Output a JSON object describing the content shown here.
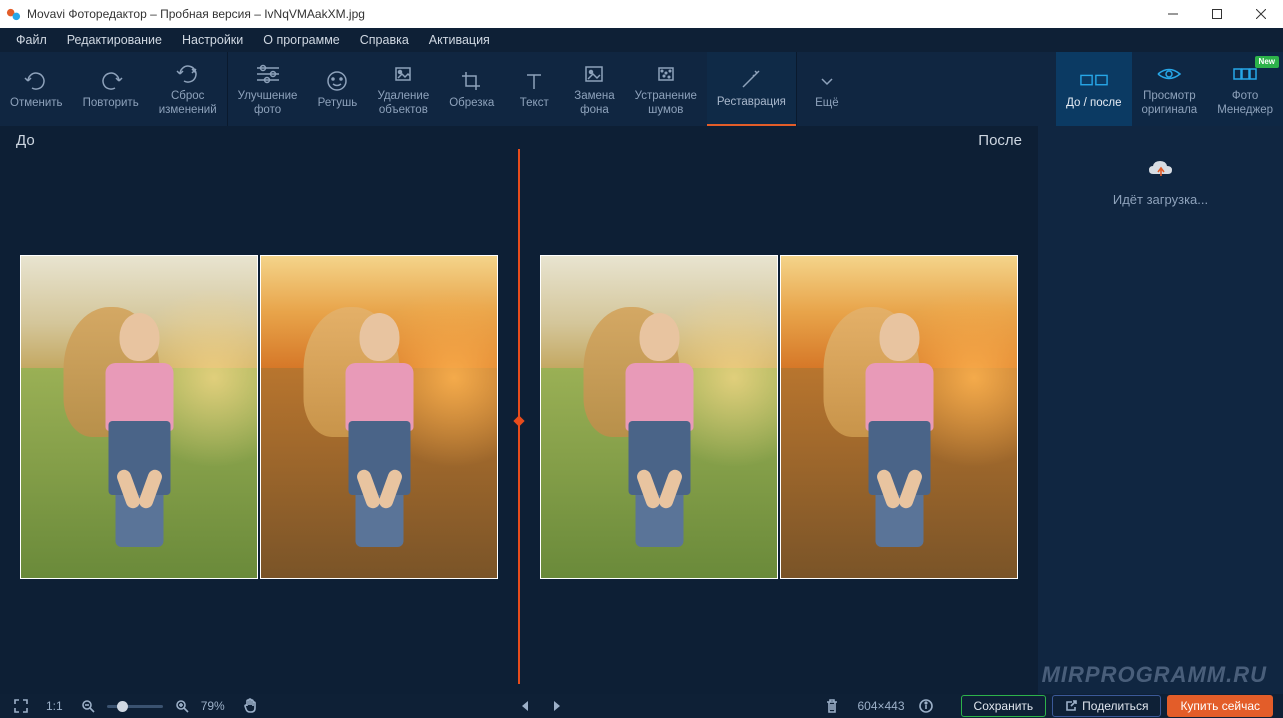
{
  "title": "Movavi Фоторедактор – Пробная версия – IvNqVMAakXM.jpg",
  "menu": {
    "file": "Файл",
    "edit": "Редактирование",
    "settings": "Настройки",
    "about": "О программе",
    "help": "Справка",
    "activation": "Активация"
  },
  "toolbar": {
    "undo": "Отменить",
    "redo": "Повторить",
    "reset": "Сброс\nизменений",
    "enhance": "Улучшение\nфото",
    "retouch": "Ретушь",
    "remove": "Удаление\nобъектов",
    "crop": "Обрезка",
    "text": "Текст",
    "bg": "Замена\nфона",
    "noise": "Устранение\nшумов",
    "restore": "Реставрация",
    "more": "Ещё",
    "compare": "До / после",
    "original": "Просмотр\nоригинала",
    "manager": "Фото\nМенеджер",
    "new_badge": "New"
  },
  "canvas": {
    "before": "До",
    "after": "После"
  },
  "side": {
    "loading": "Идёт загрузка..."
  },
  "bottom": {
    "ratio": "1:1",
    "zoom": "79%",
    "dims": "604×443",
    "save": "Сохранить",
    "share": "Поделиться",
    "buy": "Купить сейчас"
  },
  "watermark": "MIRPROGRAMM.RU"
}
